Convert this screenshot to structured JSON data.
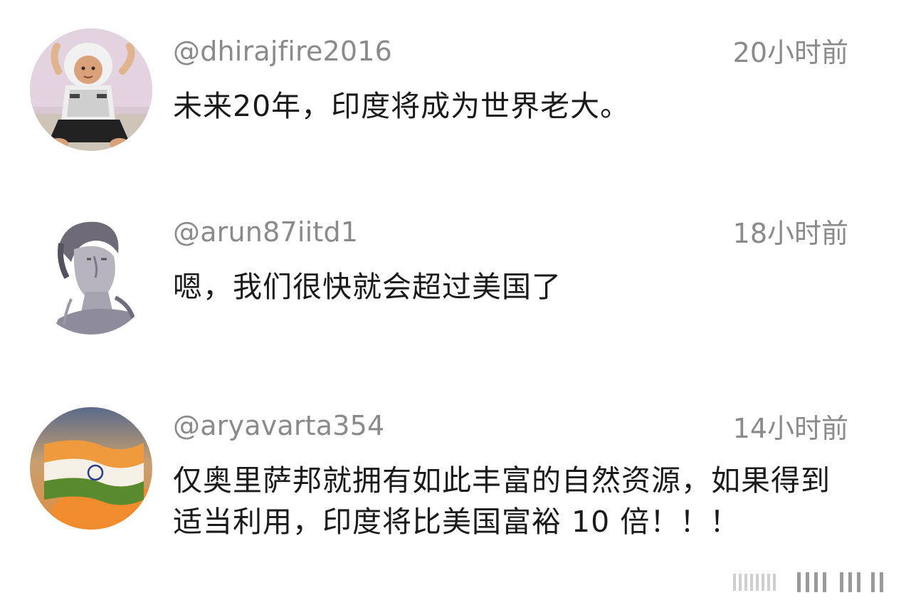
{
  "comments": [
    {
      "username": "@dhirajfire2016",
      "time": "20小时前",
      "text": "未来20年，印度将成为世界老大。",
      "avatar_icon": "child-photo-avatar"
    },
    {
      "username": "@arun87iitd1",
      "time": "18小时前",
      "text": "嗯，我们很快就会超过美国了",
      "avatar_icon": "statue-bust-avatar"
    },
    {
      "username": "@aryavarta354",
      "time": "14小时前",
      "text": "仅奥里萨邦就拥有如此丰富的自然资源，如果得到适当利用，印度将比美国富裕 10 倍！！！",
      "avatar_icon": "indian-flag-avatar"
    }
  ],
  "colors": {
    "meta_text": "#8a8a8a",
    "body_text": "#1a1a1a",
    "background": "#ffffff"
  }
}
